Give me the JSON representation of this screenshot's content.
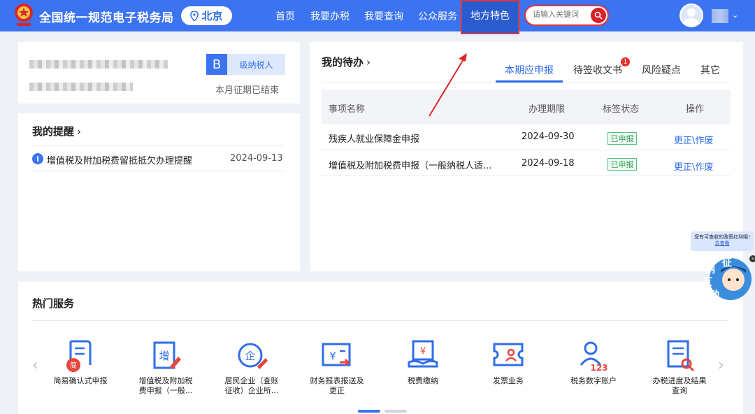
{
  "header": {
    "site_title": "全国统一规范电子税务局",
    "city": "北京",
    "nav": [
      "首页",
      "我要办税",
      "我要查询",
      "公众服务"
    ],
    "nav_active": "地方特色",
    "search_placeholder": "请输入关键词"
  },
  "profile": {
    "level_badge": "B",
    "level_label": "级纳税人",
    "period_status": "本月征期已结束"
  },
  "reminders": {
    "title": "我的提醒",
    "items": [
      {
        "text": "增值税及附加税费留抵抵欠办理提醒",
        "date": "2024-09-13"
      }
    ]
  },
  "todo": {
    "title": "我的待办",
    "tabs": [
      "本期应申报",
      "待签收文书",
      "风险疑点",
      "其它"
    ],
    "unsigned_badge": "1",
    "columns": [
      "事项名称",
      "办理期限",
      "标签状态",
      "操作"
    ],
    "rows": [
      {
        "name": "残疾人就业保障金申报",
        "deadline": "2024-09-30",
        "status": "已申报",
        "action": "更正\\作废"
      },
      {
        "name": "增值税及附加税费申报（一般纳税人适...",
        "deadline": "2024-09-18",
        "status": "已申报",
        "action": "更正\\作废"
      }
    ]
  },
  "hot_services": {
    "title": "热门服务",
    "items": [
      {
        "label1": "简易确认式申报",
        "label2": "",
        "icon": "document-simple-icon"
      },
      {
        "label1": "增值税及附加税",
        "label2": "费申报（一般...",
        "icon": "vat-declare-icon"
      },
      {
        "label1": "居民企业（查账",
        "label2": "征收）企业所...",
        "icon": "enterprise-tax-icon"
      },
      {
        "label1": "财务报表报送及",
        "label2": "更正",
        "icon": "financial-report-icon"
      },
      {
        "label1": "税费缴纳",
        "label2": "",
        "icon": "tax-payment-icon"
      },
      {
        "label1": "发票业务",
        "label2": "",
        "icon": "invoice-icon"
      },
      {
        "label1": "税务数字账户",
        "label2": "",
        "icon": "digital-account-icon"
      },
      {
        "label1": "办税进度及结果",
        "label2": "查询",
        "icon": "progress-query-icon"
      }
    ]
  },
  "float_widget": {
    "tip_line1": "您有可查收的政策红利哦!",
    "tip_link": "去查看",
    "chars": [
      "征",
      "纳",
      "互",
      "动"
    ]
  },
  "colors": {
    "brand_blue": "#3b73f0",
    "highlight_red": "#e83535",
    "success_green": "#2c9e55"
  }
}
